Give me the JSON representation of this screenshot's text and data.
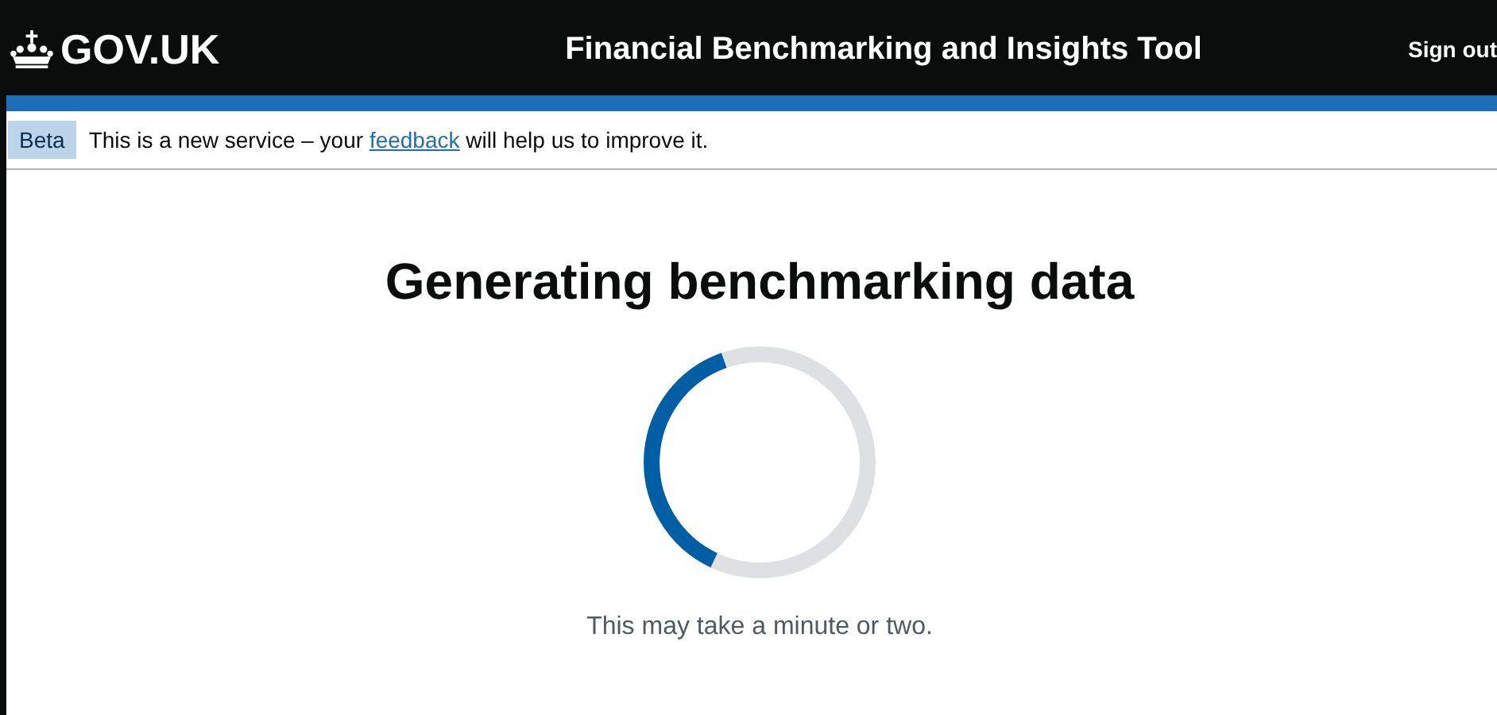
{
  "header": {
    "logo": "GOV.UK",
    "service_name": "Financial Benchmarking and Insights Tool",
    "sign_out": "Sign out"
  },
  "phase_banner": {
    "tag": "Beta",
    "text_before": "This is a new service – your",
    "link": "feedback",
    "text_after": "will help us to improve it."
  },
  "main": {
    "heading": "Generating benchmarking data",
    "message": "This may take a minute or two."
  }
}
